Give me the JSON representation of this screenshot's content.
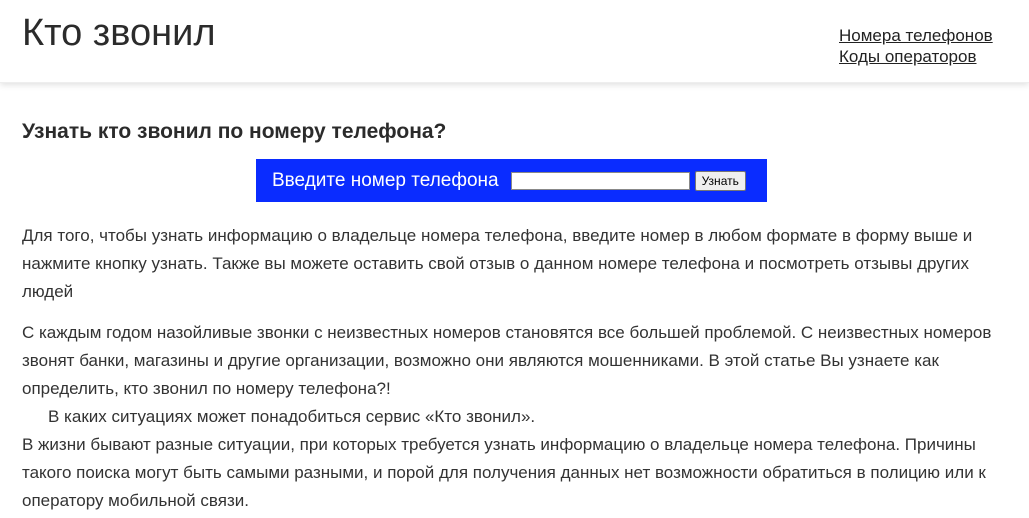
{
  "header": {
    "site_title": "Кто звонил",
    "nav": [
      {
        "label": "Номера телефонов"
      },
      {
        "label": "Коды операторов"
      }
    ]
  },
  "main": {
    "title": "Узнать кто звонил по номеру телефона?",
    "search": {
      "label": "Введите номер телефона",
      "input_value": "",
      "placeholder": "",
      "button_label": "Узнать",
      "bar_color": "#0a2cff"
    },
    "paragraphs": [
      "Для того, чтобы узнать информацию о владельце номера телефона, введите номер в любом формате в форму выше и нажмите кнопку узнать. Также вы можете оставить свой отзыв о данном номере телефона и посмотреть отзывы других людей",
      "С каждым годом назойливые звонки с неизвестных номеров становятся все большей проблемой. С неизвестных номеров звонят банки, магазины и другие организации, возможно они являются мошенниками. В этой статье Вы узнаете как определить, кто звонил по номеру телефона?!",
      "В каких ситуациях может понадобиться сервис «Кто звонил».",
      "В жизни бывают разные ситуации, при которых требуется узнать информацию о владельце номера телефона. Причины такого поиска могут быть самыми разными, и порой для получения данных нет возможности обратиться в полицию или к оператору мобильной связи."
    ]
  }
}
